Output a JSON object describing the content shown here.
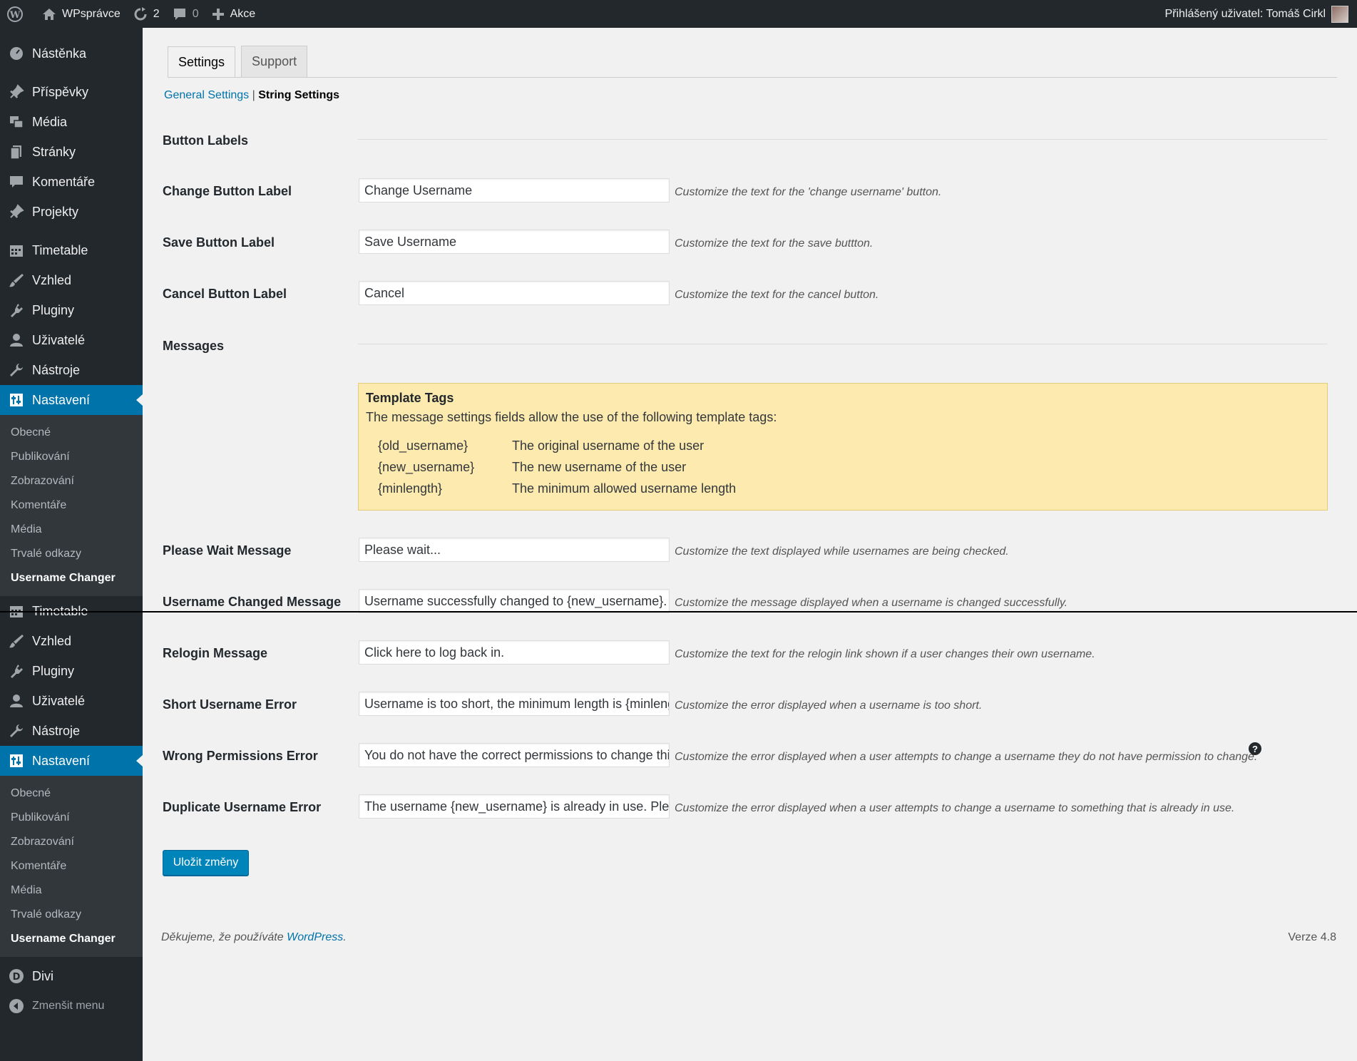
{
  "adminbar": {
    "site_name": "WPsprávce",
    "updates_count": "2",
    "comments_count": "0",
    "new_label": "Akce",
    "user_label": "Přihlášený uživatel: Tomáš Cirkl"
  },
  "sidebar": {
    "top": [
      {
        "label": "Nástěnka",
        "icon": "dashboard-icon"
      },
      {
        "label": "Příspěvky",
        "icon": "pin-icon"
      },
      {
        "label": "Média",
        "icon": "media-icon"
      },
      {
        "label": "Stránky",
        "icon": "pages-icon"
      },
      {
        "label": "Komentáře",
        "icon": "comments-icon"
      },
      {
        "label": "Projekty",
        "icon": "pin-icon"
      },
      {
        "label": "Timetable",
        "icon": "calendar-icon"
      },
      {
        "label": "Vzhled",
        "icon": "brush-icon"
      },
      {
        "label": "Pluginy",
        "icon": "plugin-icon"
      },
      {
        "label": "Uživatelé",
        "icon": "user-icon"
      },
      {
        "label": "Nástroje",
        "icon": "wrench-icon"
      },
      {
        "label": "Nastavení",
        "icon": "settings-icon"
      }
    ],
    "sub": [
      "Obecné",
      "Publikování",
      "Zobrazování",
      "Komentáře",
      "Média",
      "Trvalé odkazy",
      "Username Changer"
    ],
    "bottom": [
      {
        "label": "Timetable",
        "icon": "calendar-icon"
      },
      {
        "label": "Vzhled",
        "icon": "brush-icon"
      },
      {
        "label": "Pluginy",
        "icon": "plugin-icon"
      },
      {
        "label": "Uživatelé",
        "icon": "user-icon"
      },
      {
        "label": "Nástroje",
        "icon": "wrench-icon"
      },
      {
        "label": "Nastavení",
        "icon": "settings-icon"
      }
    ],
    "sub2": [
      "Obecné",
      "Publikování",
      "Zobrazování",
      "Komentáře",
      "Média",
      "Trvalé odkazy",
      "Username Changer"
    ],
    "divi": "Divi",
    "collapse": "Zmenšit menu"
  },
  "tabs": [
    "Settings",
    "Support"
  ],
  "subsub": {
    "general": "General Settings",
    "sep": "|",
    "string": "String Settings"
  },
  "sections": {
    "buttons": "Button Labels",
    "messages": "Messages"
  },
  "fields": {
    "change": {
      "label": "Change Button Label",
      "value": "Change Username",
      "desc": "Customize the text for the 'change username' button."
    },
    "save": {
      "label": "Save Button Label",
      "value": "Save Username",
      "desc": "Customize the text for the save buttton."
    },
    "cancel": {
      "label": "Cancel Button Label",
      "value": "Cancel",
      "desc": "Customize the text for the cancel button."
    },
    "wait": {
      "label": "Please Wait Message",
      "value": "Please wait...",
      "desc": "Customize the text displayed while usernames are being checked."
    },
    "changed": {
      "label": "Username Changed Message",
      "value": "Username successfully changed to {new_username}.",
      "desc": "Customize the message displayed when a username is changed successfully."
    },
    "relogin": {
      "label": "Relogin Message",
      "value": "Click here to log back in.",
      "desc": "Customize the text for the relogin link shown if a user changes their own username."
    },
    "short": {
      "label": "Short Username Error",
      "value": "Username is too short, the minimum length is {minlength}.",
      "desc": "Customize the error displayed when a username is too short."
    },
    "perms": {
      "label": "Wrong Permissions Error",
      "value": "You do not have the correct permissions to change this username.",
      "desc": "Customize the error displayed when a user attempts to change a username they do not have permission to change."
    },
    "dup": {
      "label": "Duplicate Username Error",
      "value": "The username {new_username} is already in use. Please try again.",
      "desc": "Customize the error displayed when a user attempts to change a username to something that is already in use."
    }
  },
  "notice": {
    "title": "Template Tags",
    "intro": "The message settings fields allow the use of the following template tags:",
    "tags": [
      {
        "tag": "{old_username}",
        "desc": "The original username of the user"
      },
      {
        "tag": "{new_username}",
        "desc": "The new username of the user"
      },
      {
        "tag": "{minlength}",
        "desc": "The minimum allowed username length"
      }
    ]
  },
  "save_button": "Uložit změny",
  "footer": {
    "thanks": "Děkujeme, že používáte ",
    "wp": "WordPress",
    "dot": ".",
    "version": "Verze 4.8"
  },
  "colors": {
    "accent": "#0073aa",
    "notice_bg": "#fdeaaf"
  }
}
